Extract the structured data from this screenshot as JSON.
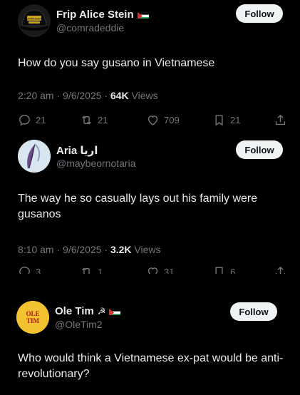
{
  "posts": [
    {
      "display_name": "Frip Alice Stein",
      "flag_icon": "palestine-flag-icon",
      "handle": "@comradeddie",
      "follow_label": "Follow",
      "avatar_text": "COMMUNISTS",
      "avatar_icon": "black-cap-avatar",
      "text": "How do you say gusano in Vietnamese",
      "time": "2:20 am · 9/6/2025 · ",
      "views_count": "64K",
      "views_label": " Views",
      "actions": {
        "replies": "21",
        "reposts": "21",
        "likes": "709",
        "bookmarks": "21"
      }
    },
    {
      "display_name": "Aria اريا",
      "handle": "@maybeornotaria",
      "follow_label": "Follow",
      "avatar_icon": "feather-avatar",
      "text": "The way he so casually lays out his family were gusanos",
      "time": "8:10 am · 9/6/2025 · ",
      "views_count": "3.2K",
      "views_label": " Views",
      "actions": {
        "replies": "3",
        "reposts": "1",
        "likes": "31",
        "bookmarks": "6"
      }
    },
    {
      "display_name": "Ole Tim",
      "name_suffix": "☭",
      "flag_icon": "palestine-flag-icon",
      "handle": "@OleTim2",
      "follow_label": "Follow",
      "avatar_text_1": "OLE",
      "avatar_text_2": "TIM",
      "text": "Who would think a Vietnamese ex-pat would be anti-revolutionary?"
    }
  ],
  "colors": {
    "background": "#000000",
    "text": "#e7e9ea",
    "muted": "#71767b",
    "button": "#eff3f4"
  }
}
